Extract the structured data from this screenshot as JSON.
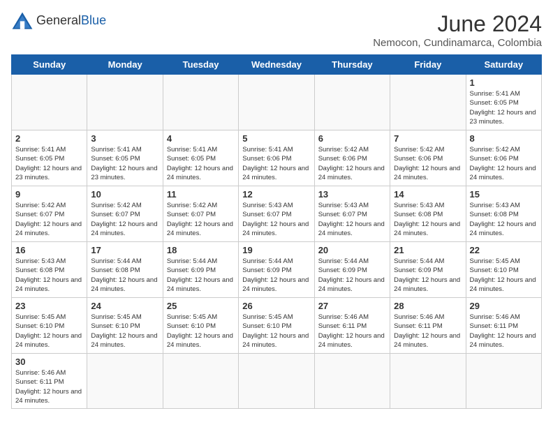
{
  "logo": {
    "text_general": "General",
    "text_blue": "Blue"
  },
  "header": {
    "month_year": "June 2024",
    "location": "Nemocon, Cundinamarca, Colombia"
  },
  "weekdays": [
    "Sunday",
    "Monday",
    "Tuesday",
    "Wednesday",
    "Thursday",
    "Friday",
    "Saturday"
  ],
  "weeks": [
    [
      {
        "day": "",
        "empty": true
      },
      {
        "day": "",
        "empty": true
      },
      {
        "day": "",
        "empty": true
      },
      {
        "day": "",
        "empty": true
      },
      {
        "day": "",
        "empty": true
      },
      {
        "day": "",
        "empty": true
      },
      {
        "day": "1",
        "sunrise": "5:41 AM",
        "sunset": "6:05 PM",
        "daylight": "12 hours and 23 minutes."
      }
    ],
    [
      {
        "day": "2",
        "sunrise": "5:41 AM",
        "sunset": "6:05 PM",
        "daylight": "12 hours and 23 minutes."
      },
      {
        "day": "3",
        "sunrise": "5:41 AM",
        "sunset": "6:05 PM",
        "daylight": "12 hours and 23 minutes."
      },
      {
        "day": "4",
        "sunrise": "5:41 AM",
        "sunset": "6:05 PM",
        "daylight": "12 hours and 24 minutes."
      },
      {
        "day": "5",
        "sunrise": "5:41 AM",
        "sunset": "6:06 PM",
        "daylight": "12 hours and 24 minutes."
      },
      {
        "day": "6",
        "sunrise": "5:42 AM",
        "sunset": "6:06 PM",
        "daylight": "12 hours and 24 minutes."
      },
      {
        "day": "7",
        "sunrise": "5:42 AM",
        "sunset": "6:06 PM",
        "daylight": "12 hours and 24 minutes."
      },
      {
        "day": "8",
        "sunrise": "5:42 AM",
        "sunset": "6:06 PM",
        "daylight": "12 hours and 24 minutes."
      }
    ],
    [
      {
        "day": "9",
        "sunrise": "5:42 AM",
        "sunset": "6:07 PM",
        "daylight": "12 hours and 24 minutes."
      },
      {
        "day": "10",
        "sunrise": "5:42 AM",
        "sunset": "6:07 PM",
        "daylight": "12 hours and 24 minutes."
      },
      {
        "day": "11",
        "sunrise": "5:42 AM",
        "sunset": "6:07 PM",
        "daylight": "12 hours and 24 minutes."
      },
      {
        "day": "12",
        "sunrise": "5:43 AM",
        "sunset": "6:07 PM",
        "daylight": "12 hours and 24 minutes."
      },
      {
        "day": "13",
        "sunrise": "5:43 AM",
        "sunset": "6:07 PM",
        "daylight": "12 hours and 24 minutes."
      },
      {
        "day": "14",
        "sunrise": "5:43 AM",
        "sunset": "6:08 PM",
        "daylight": "12 hours and 24 minutes."
      },
      {
        "day": "15",
        "sunrise": "5:43 AM",
        "sunset": "6:08 PM",
        "daylight": "12 hours and 24 minutes."
      }
    ],
    [
      {
        "day": "16",
        "sunrise": "5:43 AM",
        "sunset": "6:08 PM",
        "daylight": "12 hours and 24 minutes."
      },
      {
        "day": "17",
        "sunrise": "5:44 AM",
        "sunset": "6:08 PM",
        "daylight": "12 hours and 24 minutes."
      },
      {
        "day": "18",
        "sunrise": "5:44 AM",
        "sunset": "6:09 PM",
        "daylight": "12 hours and 24 minutes."
      },
      {
        "day": "19",
        "sunrise": "5:44 AM",
        "sunset": "6:09 PM",
        "daylight": "12 hours and 24 minutes."
      },
      {
        "day": "20",
        "sunrise": "5:44 AM",
        "sunset": "6:09 PM",
        "daylight": "12 hours and 24 minutes."
      },
      {
        "day": "21",
        "sunrise": "5:44 AM",
        "sunset": "6:09 PM",
        "daylight": "12 hours and 24 minutes."
      },
      {
        "day": "22",
        "sunrise": "5:45 AM",
        "sunset": "6:10 PM",
        "daylight": "12 hours and 24 minutes."
      }
    ],
    [
      {
        "day": "23",
        "sunrise": "5:45 AM",
        "sunset": "6:10 PM",
        "daylight": "12 hours and 24 minutes."
      },
      {
        "day": "24",
        "sunrise": "5:45 AM",
        "sunset": "6:10 PM",
        "daylight": "12 hours and 24 minutes."
      },
      {
        "day": "25",
        "sunrise": "5:45 AM",
        "sunset": "6:10 PM",
        "daylight": "12 hours and 24 minutes."
      },
      {
        "day": "26",
        "sunrise": "5:45 AM",
        "sunset": "6:10 PM",
        "daylight": "12 hours and 24 minutes."
      },
      {
        "day": "27",
        "sunrise": "5:46 AM",
        "sunset": "6:11 PM",
        "daylight": "12 hours and 24 minutes."
      },
      {
        "day": "28",
        "sunrise": "5:46 AM",
        "sunset": "6:11 PM",
        "daylight": "12 hours and 24 minutes."
      },
      {
        "day": "29",
        "sunrise": "5:46 AM",
        "sunset": "6:11 PM",
        "daylight": "12 hours and 24 minutes."
      }
    ],
    [
      {
        "day": "30",
        "sunrise": "5:46 AM",
        "sunset": "6:11 PM",
        "daylight": "12 hours and 24 minutes."
      },
      {
        "day": "",
        "empty": true
      },
      {
        "day": "",
        "empty": true
      },
      {
        "day": "",
        "empty": true
      },
      {
        "day": "",
        "empty": true
      },
      {
        "day": "",
        "empty": true
      },
      {
        "day": "",
        "empty": true
      }
    ]
  ]
}
